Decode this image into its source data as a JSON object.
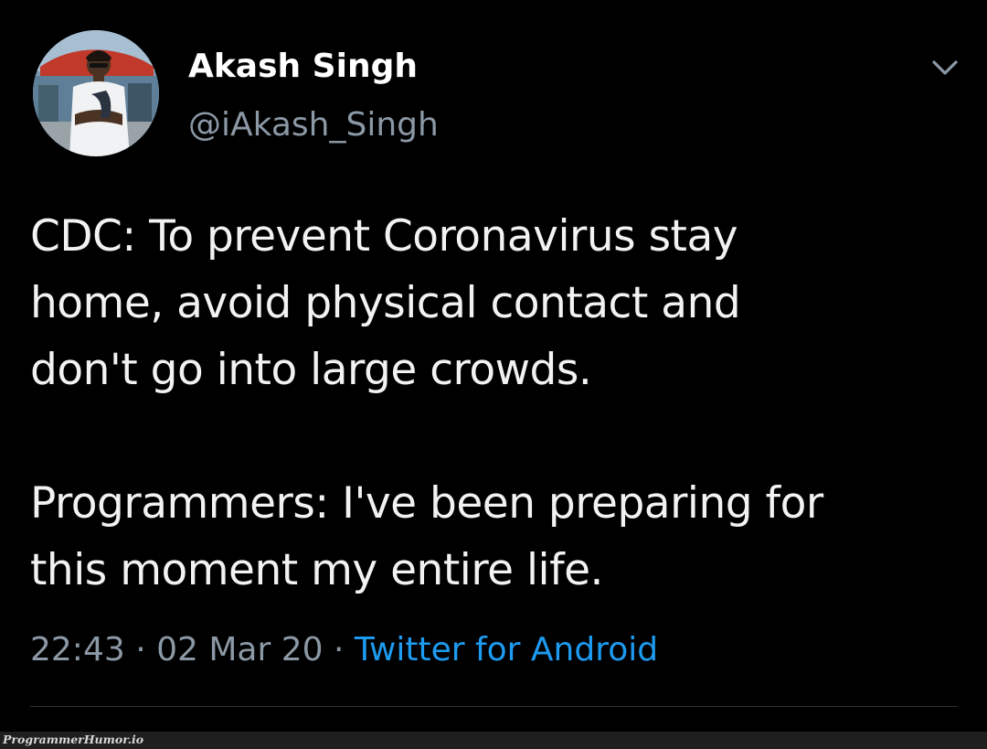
{
  "tweet": {
    "author": {
      "display_name": "Akash Singh",
      "handle": "@iAkash_Singh",
      "avatar_icon": "profile-photo"
    },
    "menu_icon": "chevron-down-icon",
    "text_lines": [
      "CDC: To prevent Coronavirus stay",
      "home, avoid physical contact and",
      "don't go into large crowds.",
      "",
      "Programmers: I've been preparing for",
      "this moment my entire life."
    ],
    "meta": {
      "time": "22:43",
      "separator": " · ",
      "date": "02 Mar 20",
      "source": "Twitter for Android"
    }
  },
  "watermark": "ProgrammerHumor.io",
  "colors": {
    "background": "#000000",
    "text": "#f2f2f2",
    "muted": "#8b98a5",
    "link": "#1d9bf0"
  }
}
